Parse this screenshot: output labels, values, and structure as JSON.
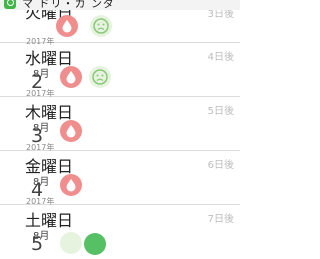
{
  "app": {
    "title": "マ ドリ・カ ンダ"
  },
  "days": [
    {
      "weekday": "火曜日",
      "days_after": "3日後",
      "month": "",
      "day": "",
      "year": "2017年"
    },
    {
      "weekday": "水曜日",
      "days_after": "4日後",
      "month": "8月",
      "day": "2",
      "year": "2017年"
    },
    {
      "weekday": "木曜日",
      "days_after": "5日後",
      "month": "8月",
      "day": "3",
      "year": "2017年"
    },
    {
      "weekday": "金曜日",
      "days_after": "6日後",
      "month": "8月",
      "day": "4",
      "year": "2017年"
    },
    {
      "weekday": "土曜日",
      "days_after": "7日後",
      "month": "8月",
      "day": "5",
      "year": ""
    }
  ],
  "icons": {
    "period": "blood-drop-icon",
    "mood": "frown-face-icon"
  },
  "colors": {
    "period_badge": "#f08d8d",
    "mood_badge": "#e6f3de",
    "mood_stroke": "#8bc77a",
    "accent_green": "#55c064",
    "weekday_text": "#222222",
    "days_after_text": "#bdbdbd"
  }
}
